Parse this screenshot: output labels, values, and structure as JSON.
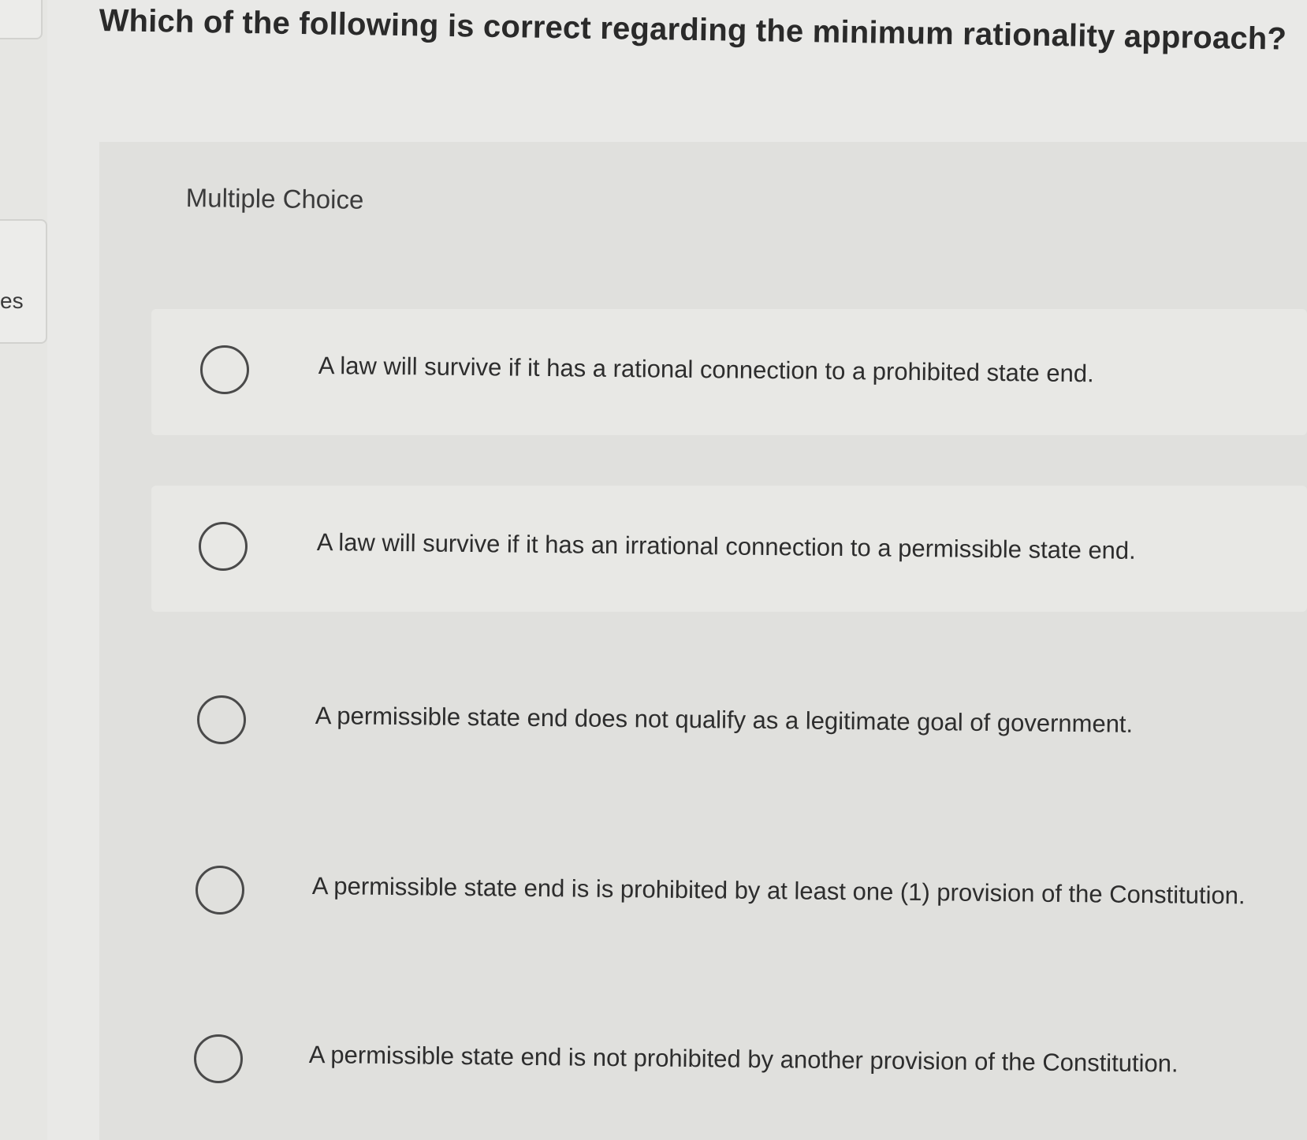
{
  "sidebar": {
    "partial_text": "es"
  },
  "question": {
    "text": "Which of the following is correct regarding the minimum rationality approach?"
  },
  "question_type": "Multiple Choice",
  "options": [
    {
      "label": "A law will survive if it has a rational connection to a prohibited state end."
    },
    {
      "label": "A law will survive if it has an irrational connection to a permissible state end."
    },
    {
      "label": "A permissible state end does not qualify as a legitimate goal of government."
    },
    {
      "label": "A permissible state end is is prohibited by at least one (1) provision of the Constitution."
    },
    {
      "label": "A permissible state end is not prohibited by another provision of the Constitution."
    }
  ]
}
